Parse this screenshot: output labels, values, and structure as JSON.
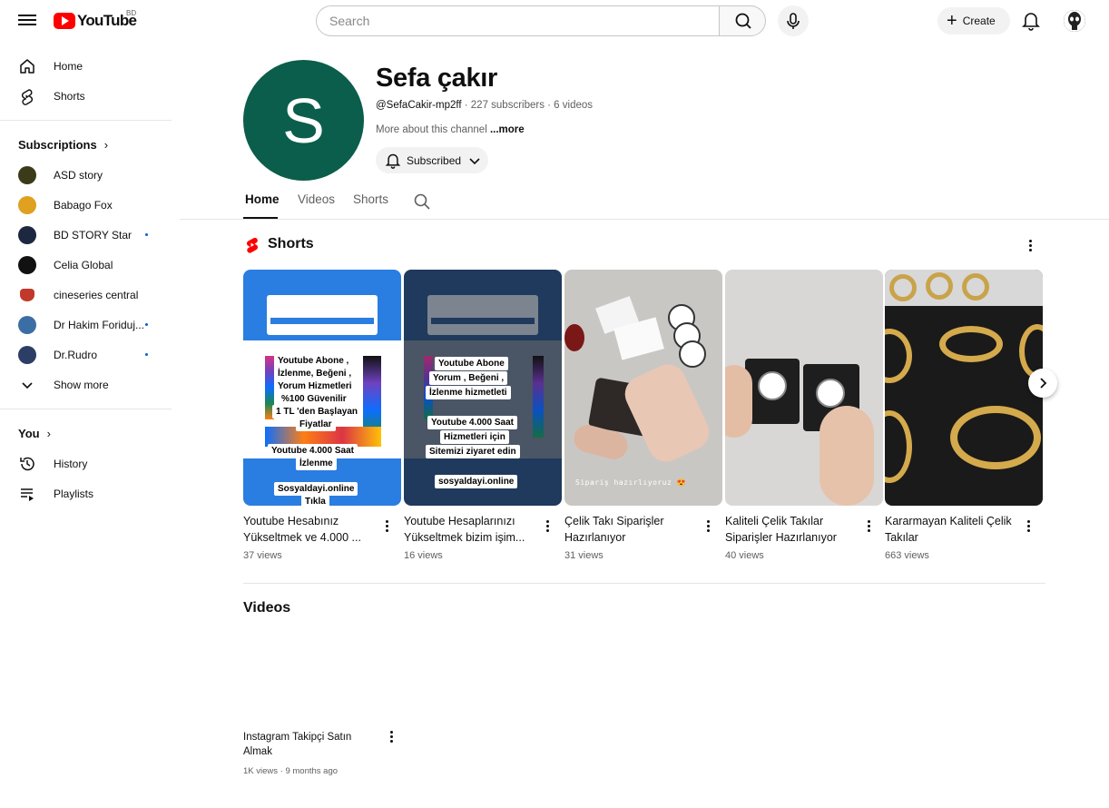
{
  "header": {
    "logo_text": "YouTube",
    "region": "BD",
    "search_placeholder": "Search",
    "create_label": "Create"
  },
  "sidebar": {
    "main": [
      {
        "label": "Home",
        "icon": "home-icon"
      },
      {
        "label": "Shorts",
        "icon": "shorts-icon"
      }
    ],
    "subscriptions_title": "Subscriptions",
    "subscriptions": [
      {
        "label": "ASD story",
        "color": "#3b3b1a",
        "live": false
      },
      {
        "label": "Babago Fox",
        "color": "#e0a020",
        "live": false
      },
      {
        "label": "BD STORY Star",
        "color": "#1c2740",
        "live": true
      },
      {
        "label": "Celia Global",
        "color": "#111111",
        "live": false
      },
      {
        "label": "cineseries central",
        "color": "#c0392b",
        "live": false
      },
      {
        "label": "Dr Hakim Foriduj...",
        "color": "#3a6ea5",
        "live": true
      },
      {
        "label": "Dr.Rudro",
        "color": "#2c3e66",
        "live": true
      }
    ],
    "show_more": "Show more",
    "you_title": "You",
    "you_items": [
      {
        "label": "History",
        "icon": "history-icon"
      },
      {
        "label": "Playlists",
        "icon": "playlists-icon"
      }
    ]
  },
  "channel": {
    "avatar_letter": "S",
    "avatar_color": "#0b5e4b",
    "name": "Sefa çakır",
    "handle": "@SefaCakir-mp2ff",
    "stats": " · 227 subscribers · 6 videos",
    "about": "More about this channel ",
    "about_more": "...more",
    "subscribed_label": "Subscribed"
  },
  "tabs": [
    "Home",
    "Videos",
    "Shorts"
  ],
  "shorts_section": {
    "title": "Shorts",
    "items": [
      {
        "title": "Youtube Hesabınız Yükseltmek ve 4.000 ...",
        "views": "37 views"
      },
      {
        "title": "Youtube Hesaplarınızı Yükseltmek bizim işim...",
        "views": "16 views"
      },
      {
        "title": "Çelik Takı  Siparişler Hazırlanıyor",
        "views": "31 views"
      },
      {
        "title": "Kaliteli Çelik Takılar Siparişler Hazırlanıyor",
        "views": "40 views"
      },
      {
        "title": "Kararmayan Kaliteli Çelik Takılar",
        "views": "663 views"
      }
    ]
  },
  "thumb_text": {
    "t1": [
      "Youtube Abone ,",
      "İzlenme, Beğeni ,",
      "Yorum Hizmetleri",
      "%100 Güvenilir",
      "1 TL 'den Başlayan",
      "Fiyatlar",
      "Youtube 4.000 Saat",
      "İzlenme",
      "Sosyaldayi.online",
      "Tıkla"
    ],
    "t2": [
      "Youtube Abone",
      "Yorum , Beğeni ,",
      "İzlenme hizmetleti",
      "Youtube 4.000 Saat",
      "Hizmetleri için",
      "Sitemizi ziyaret edin",
      "sosyaldayi.online"
    ],
    "t3_caption": "Sipariş hazırlıyoruz 😍"
  },
  "videos_section": {
    "title": "Videos",
    "items": [
      {
        "title": "Instagram Takipçi Satın Almak",
        "meta": "1K views · 9 months ago"
      }
    ]
  }
}
